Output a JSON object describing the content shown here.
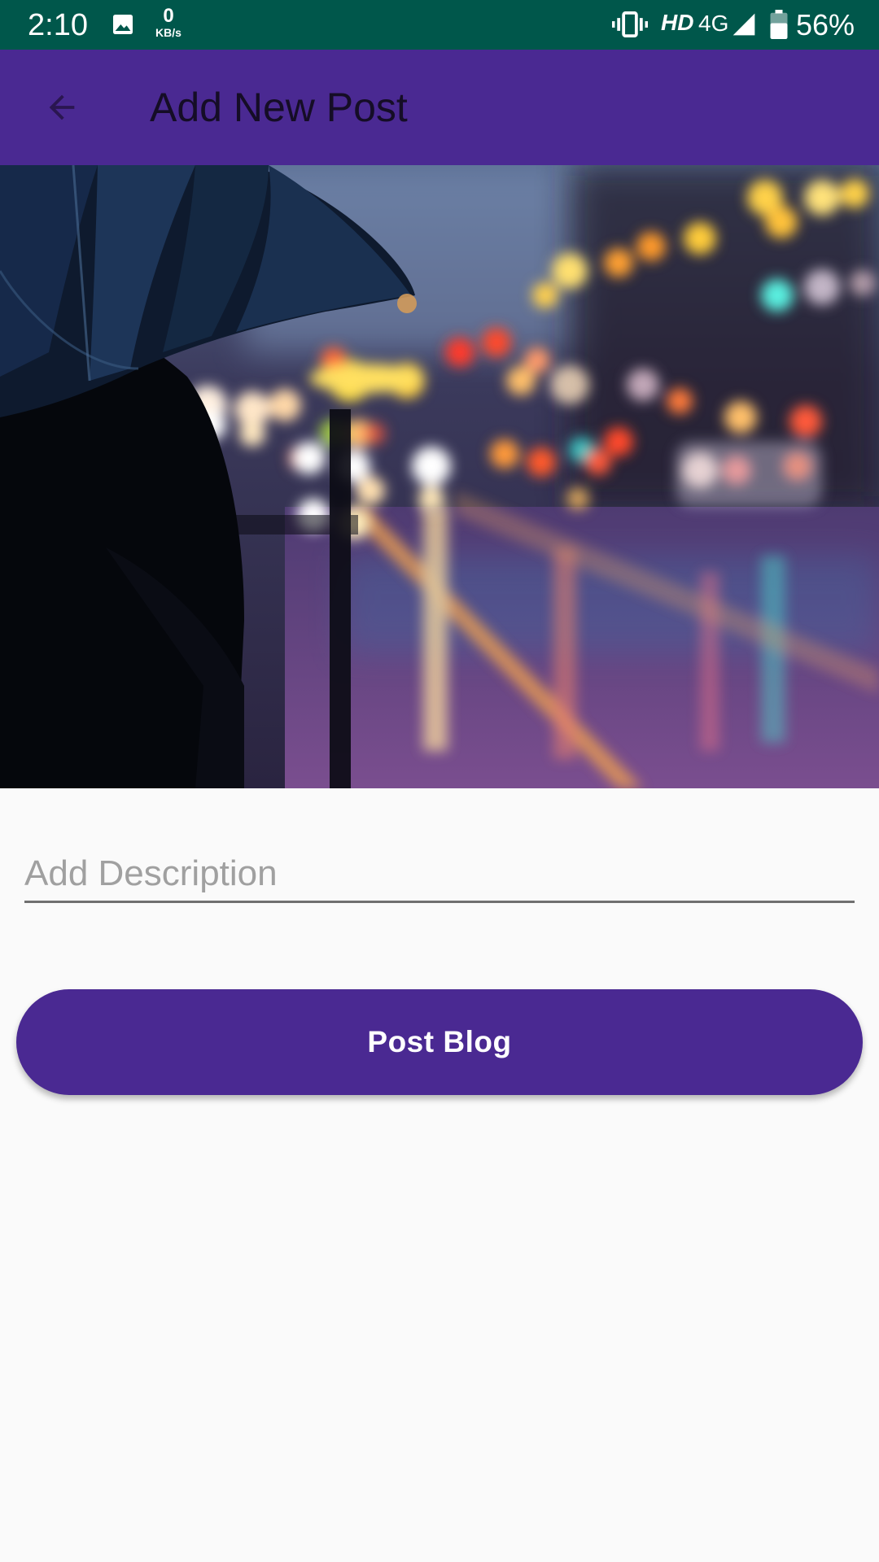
{
  "status_bar": {
    "time": "2:10",
    "net_speed_value": "0",
    "net_speed_unit": "KB/s",
    "hd_label": "HD",
    "network_type": "4G",
    "battery_percent": "56%",
    "icons": [
      "gallery-icon",
      "vibrate-icon",
      "signal-icon",
      "battery-icon"
    ],
    "color": "#00574b"
  },
  "app_bar": {
    "title": "Add New Post",
    "back_icon": "arrow-left-icon",
    "color": "#4a2992",
    "title_color": "#150d26"
  },
  "form": {
    "description_placeholder": "Add Description",
    "description_value": "",
    "submit_label": "Post Blog",
    "submit_color": "#4a2992"
  }
}
